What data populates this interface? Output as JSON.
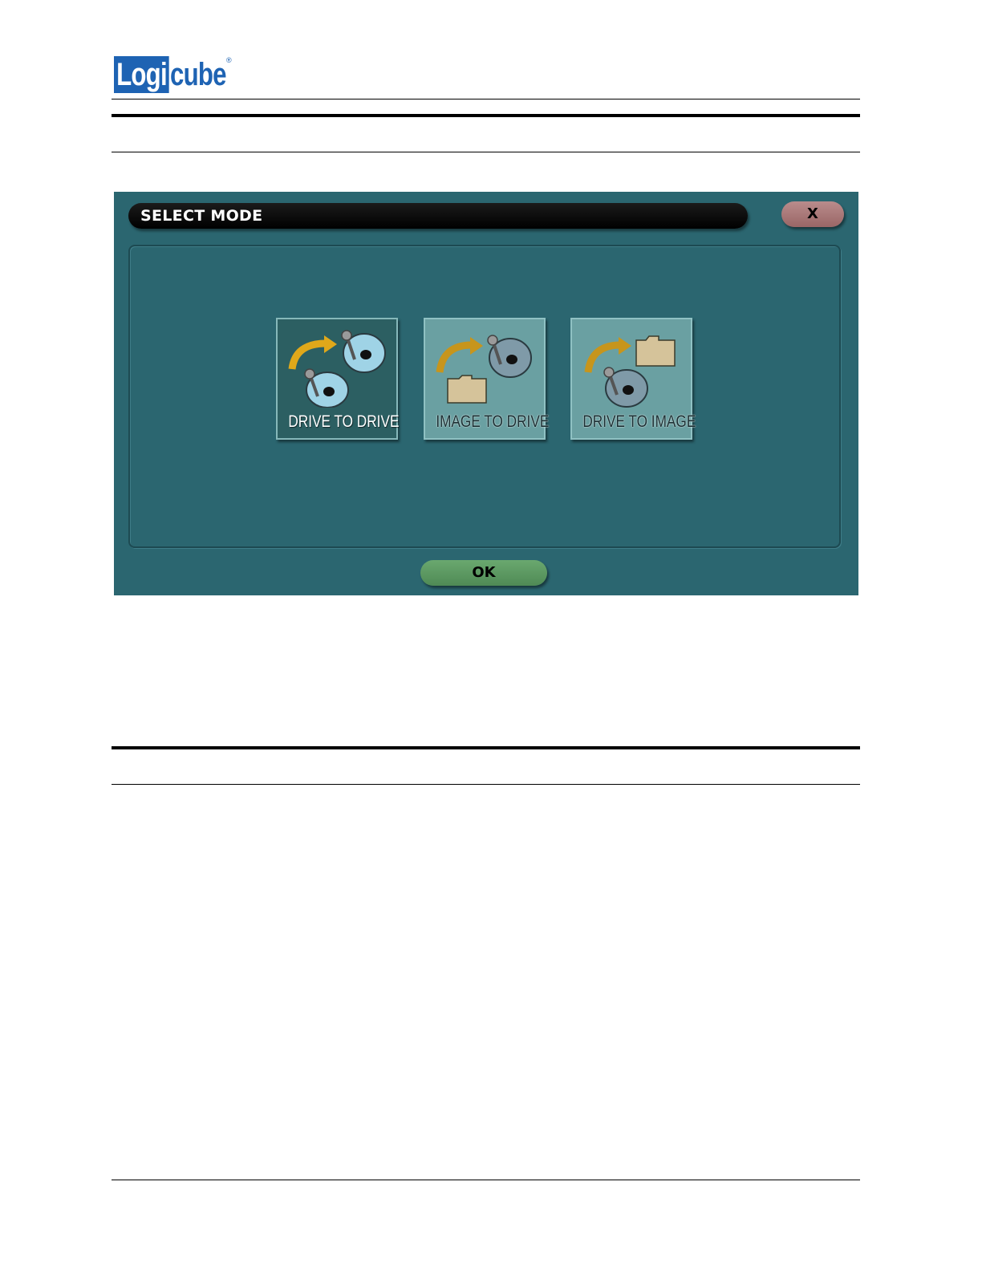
{
  "brand": {
    "logo_left": "Logi",
    "logo_right": "cube",
    "registered": "®"
  },
  "dialog": {
    "title": "SELECT MODE",
    "close_label": "X",
    "ok_label": "OK",
    "modes": [
      {
        "label": "DRIVE TO DRIVE",
        "icon": "drive-to-drive-icon",
        "selected": true
      },
      {
        "label": "IMAGE TO DRIVE",
        "icon": "image-to-drive-icon",
        "selected": false
      },
      {
        "label": "DRIVE TO IMAGE",
        "icon": "drive-to-image-icon",
        "selected": false
      }
    ]
  },
  "colors": {
    "screen_bg": "#2b6670",
    "tile_selected": "#2c5f62",
    "tile_unselected": "#6aa0a2",
    "ok_button": "#5a9a60",
    "close_button": "#a97474",
    "brand_blue": "#1e63b3"
  }
}
